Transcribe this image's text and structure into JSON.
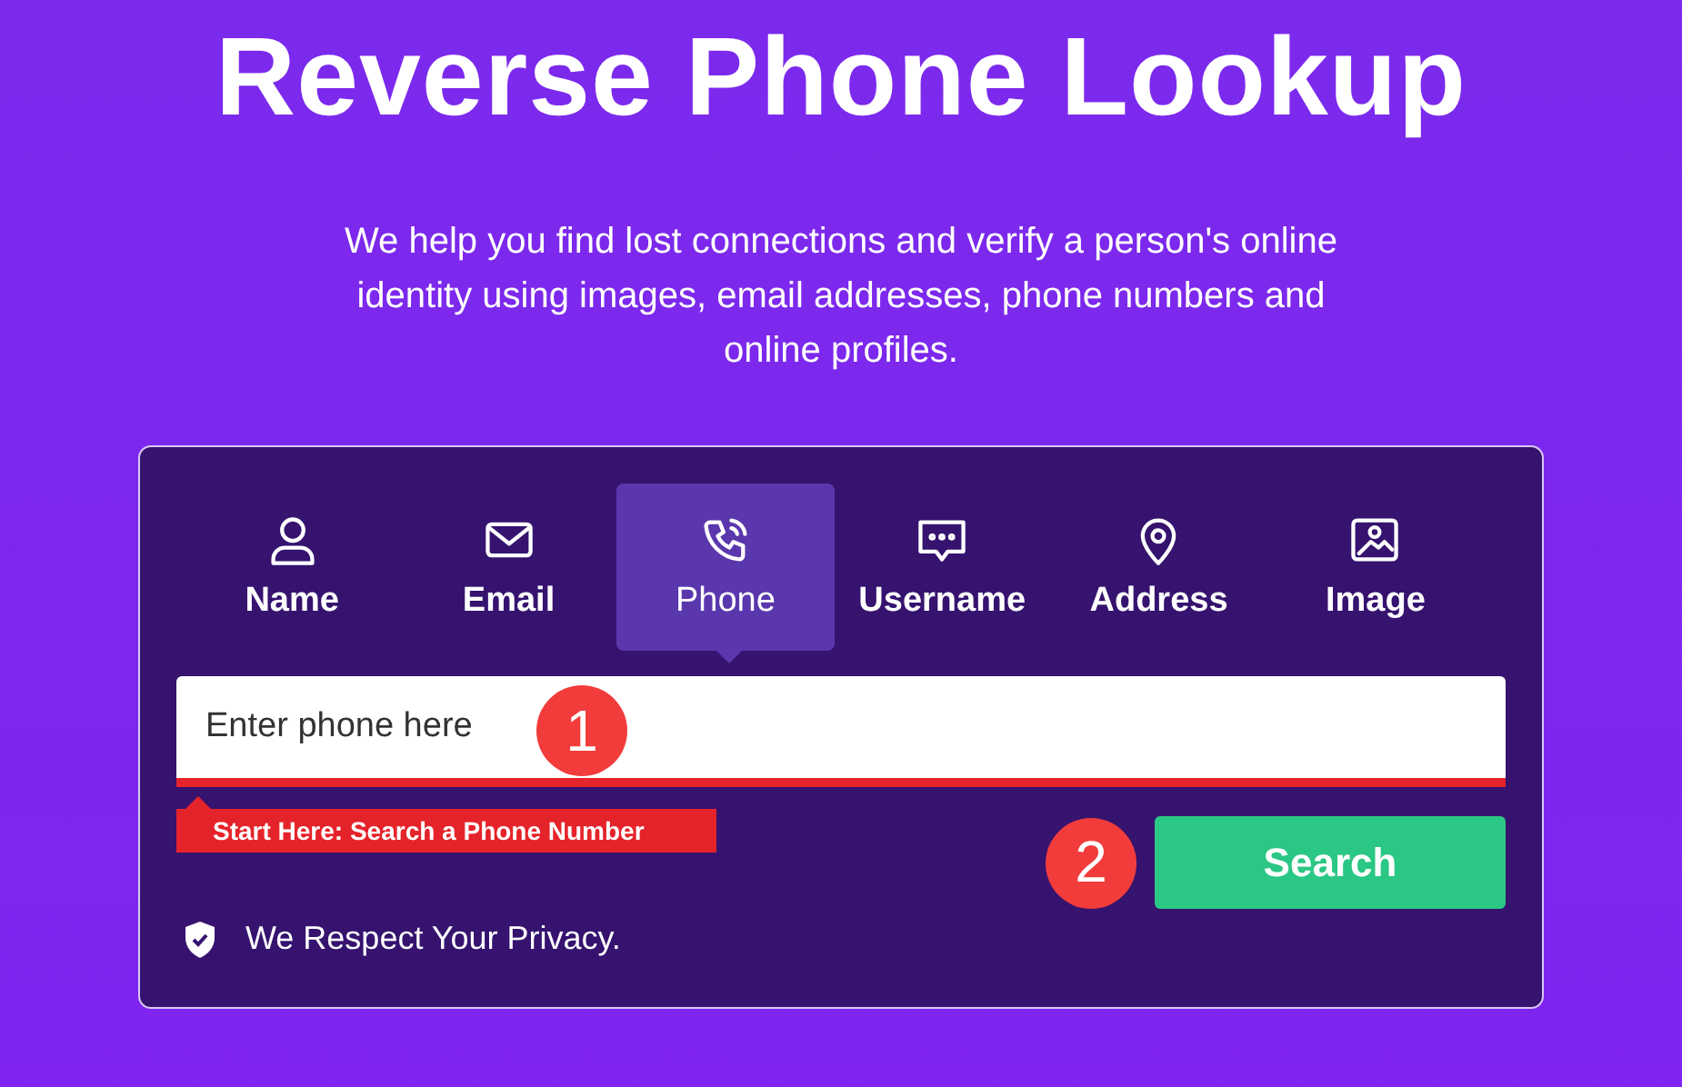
{
  "title": "Reverse Phone Lookup",
  "subtitle": "We help you find lost connections and verify a person's online identity using images, email addresses, phone numbers and online profiles.",
  "tabs": [
    {
      "label": "Name",
      "selected": false
    },
    {
      "label": "Email",
      "selected": false
    },
    {
      "label": "Phone",
      "selected": true
    },
    {
      "label": "Username",
      "selected": false
    },
    {
      "label": "Address",
      "selected": false
    },
    {
      "label": "Image",
      "selected": false
    }
  ],
  "search_field": {
    "placeholder": "Enter phone here"
  },
  "hint": "Start Here: Search a Phone Number",
  "search_button": "Search",
  "step_markers": [
    "1",
    "2"
  ],
  "privacy_note": "We Respect Your Privacy."
}
